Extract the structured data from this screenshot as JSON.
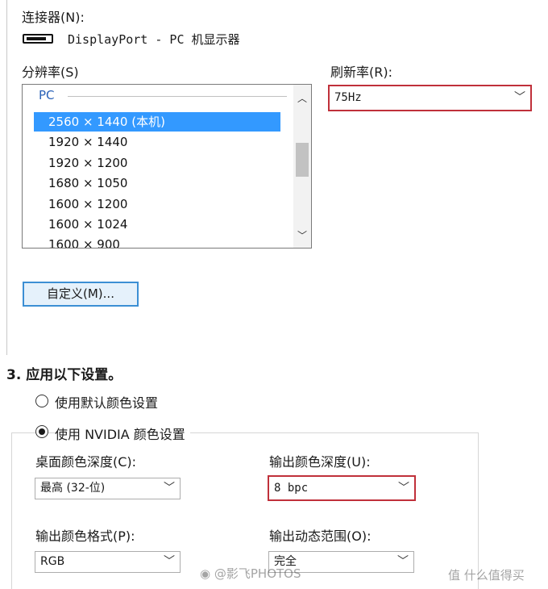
{
  "connector": {
    "label": "连接器(N):",
    "icon": "displayport-connector-icon",
    "value": "DisplayPort - PC 机显示器"
  },
  "resolution": {
    "label": "分辨率(S)",
    "group": "PC",
    "items": [
      {
        "text": "2560 × 1440 (本机)",
        "selected": true
      },
      {
        "text": "1920 × 1440",
        "selected": false
      },
      {
        "text": "1920 × 1200",
        "selected": false
      },
      {
        "text": "1680 × 1050",
        "selected": false
      },
      {
        "text": "1600 × 1200",
        "selected": false
      },
      {
        "text": "1600 × 1024",
        "selected": false
      },
      {
        "text": "1600 × 900",
        "selected": false
      }
    ],
    "selection_color": "#3399ff"
  },
  "refresh": {
    "label": "刷新率(R):",
    "value": "75Hz"
  },
  "custom_button": "自定义(M)...",
  "section": {
    "title": "3. 应用以下设置。",
    "radio_default": "使用默认颜色设置",
    "radio_nvidia": "使用 NVIDIA 颜色设置",
    "selected_option": "nvidia"
  },
  "color_settings": {
    "desktop_depth_label": "桌面颜色深度(C):",
    "desktop_depth_value": "最高 (32-位)",
    "output_depth_label": "输出颜色深度(U):",
    "output_depth_value": "8 bpc",
    "output_format_label": "输出颜色格式(P):",
    "output_format_value": "RGB",
    "dynamic_range_label": "输出动态范围(O):",
    "dynamic_range_value": "完全"
  },
  "highlight_color": "#c0303a",
  "watermarks": {
    "weibo": "@影飞PHOTOS",
    "site": "什么值得买"
  }
}
